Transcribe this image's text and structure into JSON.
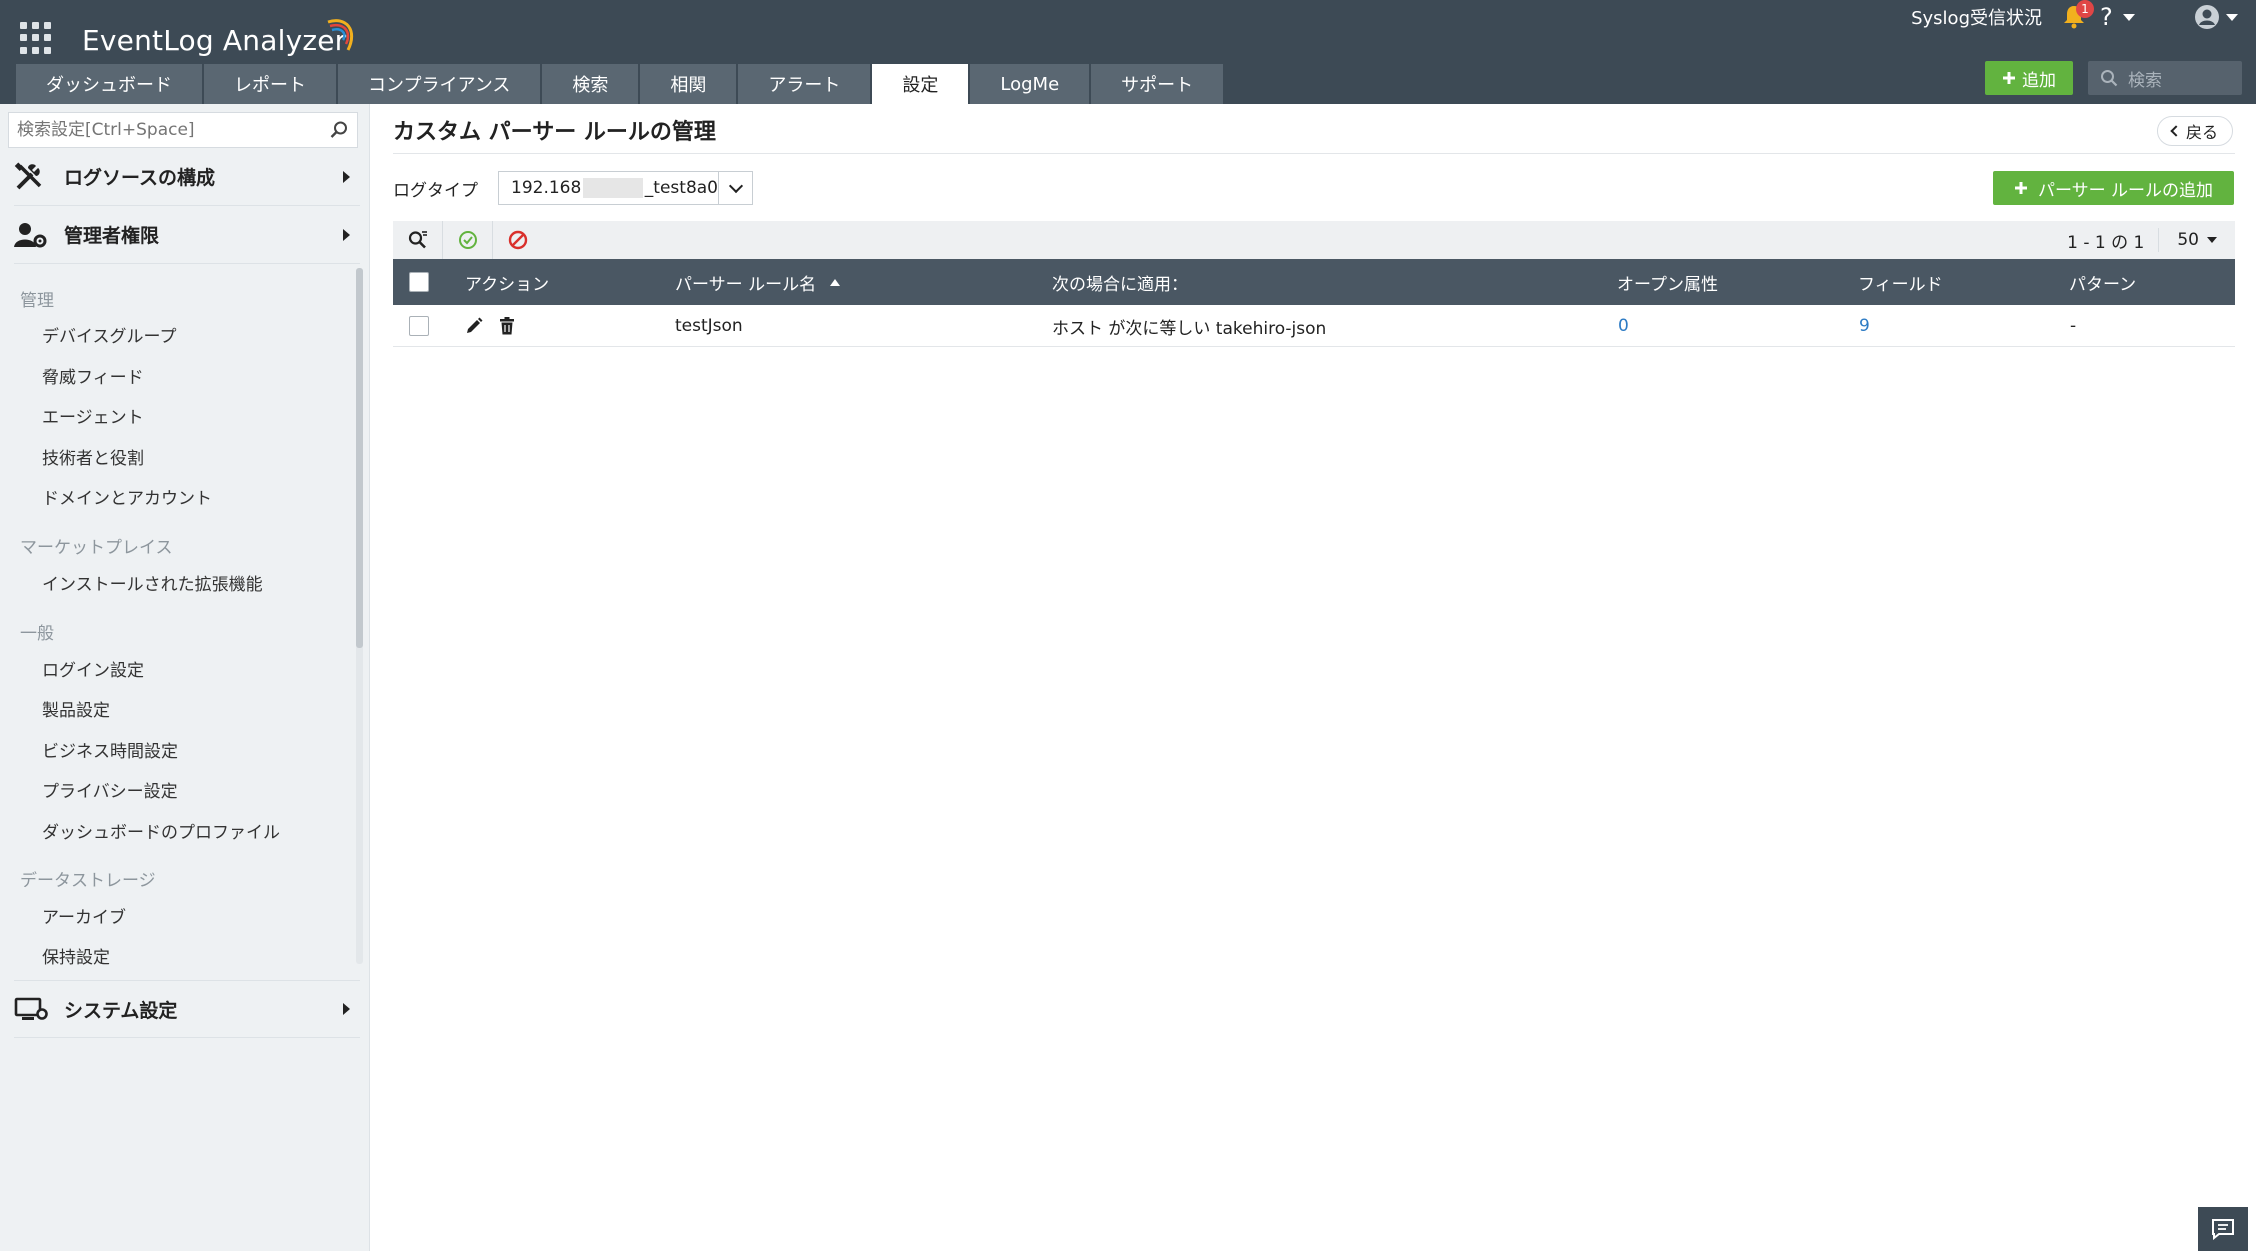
{
  "app": {
    "brand": "EventLog Analyzer",
    "accent_green": "#62b33f",
    "header_bg": "#3d4a55",
    "link_color": "#2d7bc4"
  },
  "header": {
    "syslog_status": "Syslog受信状況",
    "notification_count": "1",
    "help_label": "?",
    "add_label": "追加",
    "search_placeholder": "検索",
    "tabs": [
      {
        "label": "ダッシュボード"
      },
      {
        "label": "レポート"
      },
      {
        "label": "コンプライアンス"
      },
      {
        "label": "検索"
      },
      {
        "label": "相関"
      },
      {
        "label": "アラート"
      },
      {
        "label": "設定",
        "active": true
      },
      {
        "label": "LogMe"
      },
      {
        "label": "サポート"
      }
    ]
  },
  "sidebar": {
    "search_placeholder": "検索設定[Ctrl+Space]",
    "sections": {
      "log_sources": "ログソースの構成",
      "admin": "管理者権限",
      "system": "システム設定"
    },
    "groups": {
      "manage": "管理",
      "marketplace": "マーケットプレイス",
      "general": "一般",
      "storage": "データストレージ"
    },
    "items": {
      "device_groups": "デバイスグループ",
      "threat_feeds": "脅威フィード",
      "agents": "エージェント",
      "technicians": "技術者と役割",
      "domains": "ドメインとアカウント",
      "extensions": "インストールされた拡張機能",
      "login": "ログイン設定",
      "product": "製品設定",
      "business_hours": "ビジネス時間設定",
      "privacy": "プライバシー設定",
      "dashboard_profile": "ダッシュボードのプロファイル",
      "archive": "アーカイブ",
      "retention": "保持設定"
    }
  },
  "main": {
    "title": "カスタム パーサー ルールの管理",
    "back_label": "戻る",
    "logtype_label": "ログタイプ",
    "logtype_prefix": "192.168",
    "logtype_suffix": "_test8a0",
    "add_rule_label": "パーサー ルールの追加",
    "pager_text": "1 - 1 の 1",
    "page_size": "50",
    "columns": {
      "action": "アクション",
      "rule_name": "パーサー ルール名",
      "applies_when": "次の場合に適用：",
      "open_attrs": "オープン属性",
      "fields": "フィールド",
      "pattern": "パターン"
    },
    "rows": [
      {
        "rule_name": "testJson",
        "applies_when": "ホスト が次に等しい takehiro-json",
        "open_attrs": "0",
        "fields": "9",
        "pattern": "-"
      }
    ]
  }
}
